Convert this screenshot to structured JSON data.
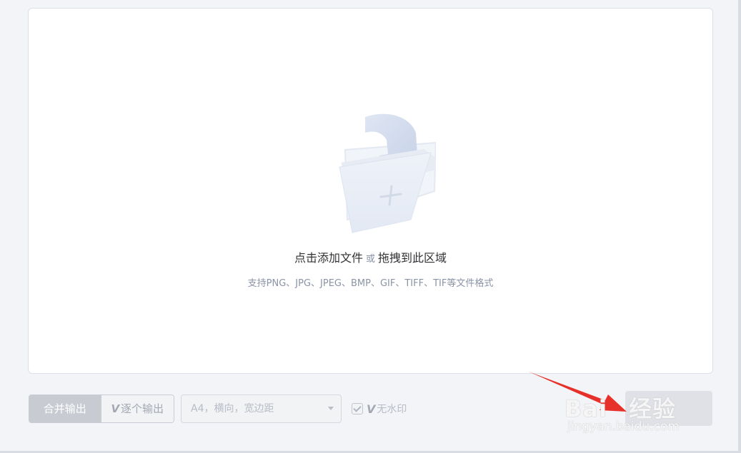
{
  "dropzone": {
    "primary_action": "点击添加文件",
    "or_text": "或",
    "secondary_action": "拖拽到此区域",
    "supported_formats": "支持PNG、JPG、JPEG、BMP、GIF、TIFF、TIF等文件格式"
  },
  "output_mode": {
    "options": [
      "合并输出",
      "逐个输出"
    ],
    "selected": "合并输出",
    "vip_badge": "V"
  },
  "page_settings": {
    "value": "A4，横向，宽边距",
    "icon": "caret-down-icon"
  },
  "watermark": {
    "vip_badge": "V",
    "label": "无水印",
    "checked": true
  },
  "annotation": {
    "color": "#e8302a"
  },
  "baidu_watermark": {
    "brand_latin": "Bai",
    "brand_cn": "经验",
    "url": "jingyan.baidu.com"
  },
  "colors": {
    "background": "#f3f4f7",
    "panel": "#ffffff",
    "text_primary": "#303133",
    "text_secondary": "#8a93a6",
    "disabled_text": "#b8bcc6",
    "active_segment": "#c8cbd2"
  }
}
